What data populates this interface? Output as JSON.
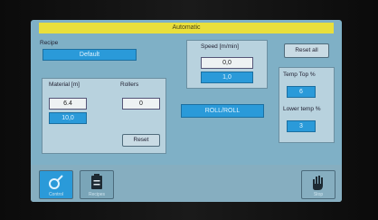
{
  "title": "Automatic",
  "recipe": {
    "label": "Recipe",
    "value": "Default"
  },
  "speed": {
    "label": "Speed [m/min]",
    "value": "0,0",
    "setpoint": "1,0"
  },
  "reset_all": "Reset all",
  "material": {
    "label": "Material [m]",
    "value": "6.4",
    "setpoint": "10,0"
  },
  "rollers": {
    "label": "Rollers",
    "value": "0"
  },
  "reset": "Reset",
  "mode": "ROLL/ROLL",
  "temp_top": {
    "label": "Temp Top %",
    "value": "6"
  },
  "lower_temp": {
    "label": "Lower temp %",
    "value": "3"
  },
  "bottom": {
    "left_label": "Control",
    "mid_label": "Recipes",
    "right_label": "Stop"
  },
  "colors": {
    "screen": "#7fb0c6",
    "titlebar": "#e9df3c",
    "accent": "#2a9ad9"
  }
}
